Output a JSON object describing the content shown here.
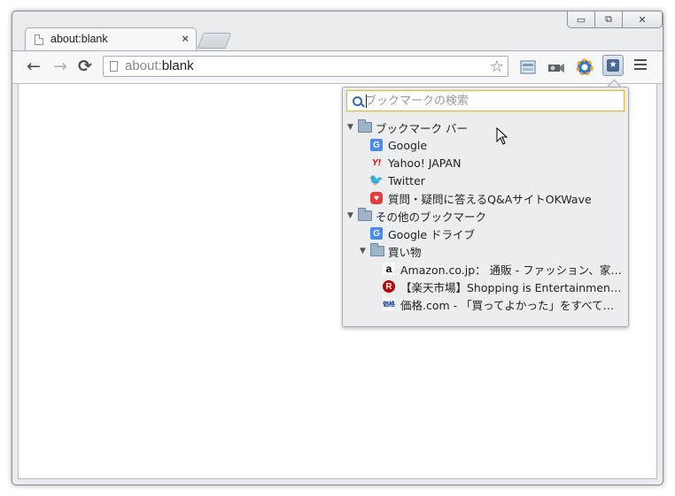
{
  "window": {
    "controls": {
      "minimize": "▭",
      "maximize": "⧉",
      "close": "✕"
    }
  },
  "tab": {
    "title": "about:blank",
    "close": "×"
  },
  "toolbar": {
    "back": "←",
    "forward": "→",
    "reload": "⟳",
    "url_scheme": "about:",
    "url_host": "blank",
    "star": "☆",
    "bookmarks_button": "★",
    "menu_icon": "hamburger-menu-icon"
  },
  "bookmarks_popup": {
    "search_placeholder": "ブックマークの検索",
    "items": [
      {
        "type": "folder",
        "expanded": true,
        "label": "ブックマーク バー",
        "level": 0
      },
      {
        "type": "link",
        "icon": "G",
        "label": "Google",
        "level": 1
      },
      {
        "type": "link",
        "icon": "Y!",
        "label": "Yahoo! JAPAN",
        "level": 1
      },
      {
        "type": "link",
        "icon": "🐦",
        "label": "Twitter",
        "level": 1
      },
      {
        "type": "link",
        "icon": "♥",
        "label": "質問・疑問に答えるQ&AサイトOKWave",
        "level": 1
      },
      {
        "type": "folder",
        "expanded": true,
        "label": "その他のブックマーク",
        "level": 0
      },
      {
        "type": "link",
        "icon": "G",
        "label": "Google ドライブ",
        "level": 1
      },
      {
        "type": "folder",
        "expanded": true,
        "label": "買い物",
        "level": 1
      },
      {
        "type": "link",
        "icon": "a",
        "label": "Amazon.co.jp： 通販 - ファッション、家…",
        "level": 2
      },
      {
        "type": "link",
        "icon": "R",
        "label": "【楽天市場】Shopping is Entertainment! …",
        "level": 2
      },
      {
        "type": "link",
        "icon": "価格",
        "label": "価格.com - 「買ってよかった」をすべての…",
        "level": 2
      }
    ]
  }
}
